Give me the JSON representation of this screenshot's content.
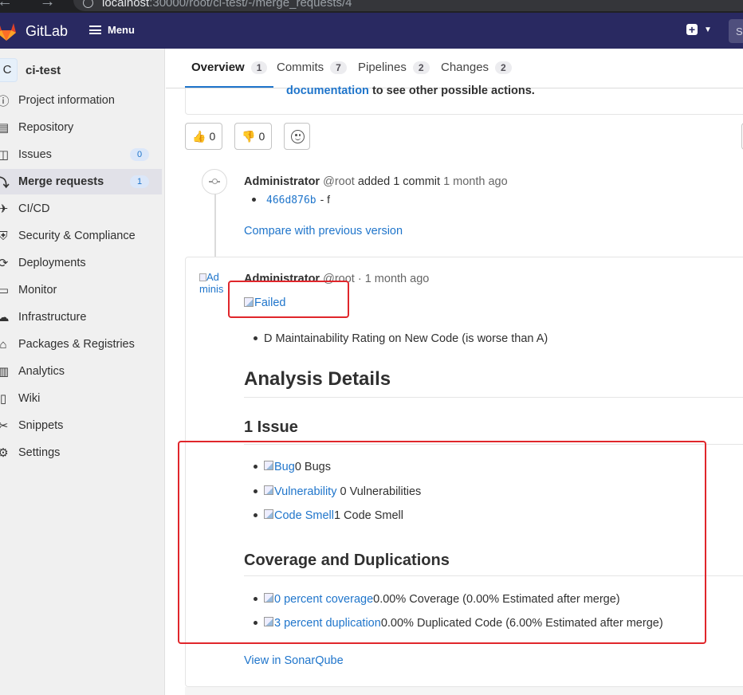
{
  "browser": {
    "url_host": "localhost",
    "url_rest": ":30000/root/ci-test/-/merge_requests/4"
  },
  "header": {
    "brand": "GitLab",
    "menu_label": "Menu",
    "search_placeholder": "S",
    "plus_icon": "plus-square-icon"
  },
  "sidebar": {
    "project_avatar": "C",
    "project_name": "ci-test",
    "items": [
      {
        "label": "Project information",
        "icon": "info-icon"
      },
      {
        "label": "Repository",
        "icon": "doc-icon"
      },
      {
        "label": "Issues",
        "icon": "issues-icon",
        "count": "0"
      },
      {
        "label": "Merge requests",
        "icon": "merge-request-icon",
        "count": "1",
        "active": true
      },
      {
        "label": "CI/CD",
        "icon": "rocket-icon"
      },
      {
        "label": "Security & Compliance",
        "icon": "shield-icon"
      },
      {
        "label": "Deployments",
        "icon": "deployments-icon"
      },
      {
        "label": "Monitor",
        "icon": "monitor-icon"
      },
      {
        "label": "Infrastructure",
        "icon": "cloud-icon"
      },
      {
        "label": "Packages & Registries",
        "icon": "package-icon"
      },
      {
        "label": "Analytics",
        "icon": "chart-icon"
      },
      {
        "label": "Wiki",
        "icon": "book-icon"
      },
      {
        "label": "Snippets",
        "icon": "scissors-icon"
      },
      {
        "label": "Settings",
        "icon": "gear-icon"
      }
    ]
  },
  "tabs": [
    {
      "label": "Overview",
      "count": "1",
      "active": true
    },
    {
      "label": "Commits",
      "count": "7"
    },
    {
      "label": "Pipelines",
      "count": "2"
    },
    {
      "label": "Changes",
      "count": "2"
    }
  ],
  "description": {
    "link": "documentation",
    "rest": " to see other possible actions."
  },
  "reactions": {
    "thumbsup": "0",
    "thumbsdown": "0"
  },
  "system_note": {
    "author": "Administrator",
    "handle": "@root",
    "action": " added 1 commit ",
    "time": "1 month ago",
    "commit_sha": "466d876b",
    "commit_msg": "- f",
    "compare_link": "Compare with previous version"
  },
  "note": {
    "avatar_alt_1": "Ad",
    "avatar_alt_2": "minis",
    "author": "Administrator",
    "handle": "@root",
    "time": " · 1 month ago",
    "status_img": "Failed",
    "condition": "D Maintainability Rating on New Code (is worse than A)",
    "h1": "Analysis Details",
    "issues_heading": "1 Issue",
    "issues": [
      {
        "img": "Bug",
        "text": "0 Bugs"
      },
      {
        "img": "Vulnerability",
        "text": "0 Vulnerabilities"
      },
      {
        "img": "Code Smell",
        "text": "1 Code Smell"
      }
    ],
    "coverage_heading": "Coverage and Duplications",
    "coverage": [
      {
        "img": "0 percent coverage",
        "text": "0.00% Coverage (0.00% Estimated after merge)"
      },
      {
        "img": "3 percent duplication",
        "text": "0.00% Duplicated Code (6.00% Estimated after merge)"
      }
    ],
    "sonar_link": "View in SonarQube"
  },
  "colors": {
    "header_bg": "#292961",
    "link": "#1f75cb",
    "annotation": "#e0262b"
  }
}
